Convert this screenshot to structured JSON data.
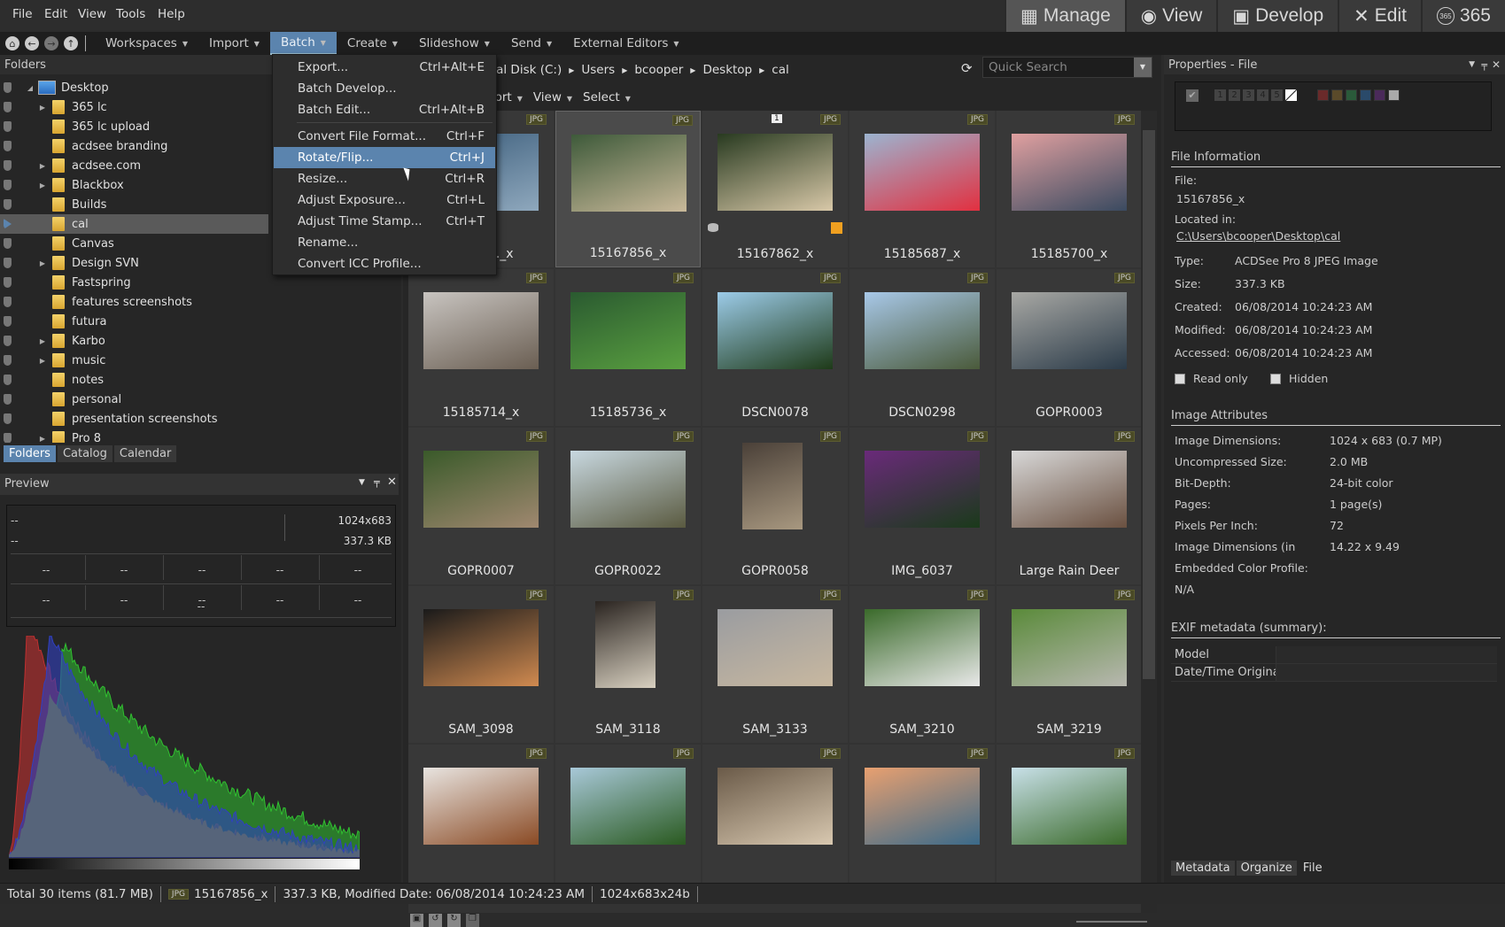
{
  "menubar": {
    "items": [
      "File",
      "Edit",
      "View",
      "Tools",
      "Help"
    ]
  },
  "modes": [
    {
      "label": "Manage",
      "icon": "grid-icon",
      "active": true
    },
    {
      "label": "View",
      "icon": "eye-icon"
    },
    {
      "label": "Develop",
      "icon": "image-icon"
    },
    {
      "label": "Edit",
      "icon": "tools-icon"
    },
    {
      "label": "365",
      "icon": "365-icon",
      "glyph": "365"
    }
  ],
  "toolbar": {
    "items": [
      "Workspaces",
      "Import",
      "Batch",
      "Create",
      "Slideshow",
      "Send",
      "External Editors"
    ],
    "active": "Batch"
  },
  "batch_menu": [
    {
      "label": "Export...",
      "shortcut": "Ctrl+Alt+E"
    },
    {
      "label": "Batch Develop...",
      "shortcut": ""
    },
    {
      "label": "Batch Edit...",
      "shortcut": "Ctrl+Alt+B"
    },
    {
      "label": "Convert File Format...",
      "shortcut": "Ctrl+F"
    },
    {
      "label": "Rotate/Flip...",
      "shortcut": "Ctrl+J",
      "highlighted": true
    },
    {
      "label": "Resize...",
      "shortcut": "Ctrl+R"
    },
    {
      "label": "Adjust Exposure...",
      "shortcut": "Ctrl+L"
    },
    {
      "label": "Adjust Time Stamp...",
      "shortcut": "Ctrl+T"
    },
    {
      "label": "Rename...",
      "shortcut": ""
    },
    {
      "label": "Convert ICC Profile...",
      "shortcut": ""
    }
  ],
  "folders": {
    "title": "Folders",
    "items": [
      {
        "label": "Desktop",
        "root": true
      },
      {
        "label": "365 lc",
        "exp": true
      },
      {
        "label": "365 lc upload"
      },
      {
        "label": "acdsee branding"
      },
      {
        "label": "acdsee.com",
        "exp": true
      },
      {
        "label": "Blackbox",
        "exp": true
      },
      {
        "label": "Builds"
      },
      {
        "label": "cal",
        "selected": true
      },
      {
        "label": "Canvas"
      },
      {
        "label": "Design SVN",
        "exp": true
      },
      {
        "label": "Fastspring"
      },
      {
        "label": "features screenshots"
      },
      {
        "label": "futura"
      },
      {
        "label": "Karbo",
        "exp": true
      },
      {
        "label": "music",
        "exp": true
      },
      {
        "label": "notes"
      },
      {
        "label": "personal"
      },
      {
        "label": "presentation screenshots"
      },
      {
        "label": "Pro 8",
        "exp": true
      }
    ],
    "tabs": [
      "Folders",
      "Catalog",
      "Calendar"
    ],
    "active_tab": "Folders"
  },
  "preview": {
    "title": "Preview",
    "dimensions": "1024x683",
    "size": "337.3 KB",
    "placeholder": "--"
  },
  "address": {
    "crumbs": [
      "Local Disk (C:)",
      "Users",
      "bcooper",
      "Desktop",
      "cal"
    ],
    "search_placeholder": "Quick Search"
  },
  "sortbar": [
    "Sort",
    "View",
    "Select"
  ],
  "thumbnails": [
    {
      "name": "15185..._x",
      "colors": [
        "#3a5c7a",
        "#8fa8bd"
      ],
      "partial": true
    },
    {
      "name": "15167856_x",
      "colors": [
        "#3e5a3a",
        "#c9b99a"
      ],
      "selected": true
    },
    {
      "name": "15167862_x",
      "colors": [
        "#283a20",
        "#d8c8a8"
      ],
      "label_num": "1",
      "tagged": true
    },
    {
      "name": "15185687_x",
      "colors": [
        "#9cb4d0",
        "#e23040"
      ]
    },
    {
      "name": "15185700_x",
      "colors": [
        "#e0a0a0",
        "#3a4a60"
      ]
    },
    {
      "name": "15185714_x",
      "colors": [
        "#c8c4c0",
        "#6a5e52"
      ]
    },
    {
      "name": "15185736_x",
      "colors": [
        "#2a5a30",
        "#5aa040"
      ]
    },
    {
      "name": "DSCN0078",
      "colors": [
        "#9ccbe8",
        "#1e3a18"
      ]
    },
    {
      "name": "DSCN0298",
      "colors": [
        "#a8c8e8",
        "#4a5a3a"
      ]
    },
    {
      "name": "GOPR0003",
      "colors": [
        "#a8a8a4",
        "#2a3a48"
      ]
    },
    {
      "name": "GOPR0007",
      "colors": [
        "#3a5a2a",
        "#a08870"
      ]
    },
    {
      "name": "GOPR0022",
      "colors": [
        "#c8d8e0",
        "#5a5a40"
      ]
    },
    {
      "name": "GOPR0058",
      "colors": [
        "#4a4038",
        "#a89880"
      ],
      "portrait": true
    },
    {
      "name": "IMG_6037",
      "colors": [
        "#6a2a7a",
        "#1a3a1a"
      ]
    },
    {
      "name": "Large Rain Deer",
      "colors": [
        "#d8d8d8",
        "#6a5040"
      ]
    },
    {
      "name": "SAM_3098",
      "colors": [
        "#1a1a1a",
        "#d08a50"
      ]
    },
    {
      "name": "SAM_3118",
      "colors": [
        "#2a2420",
        "#d8d0c0"
      ],
      "portrait": true
    },
    {
      "name": "SAM_3133",
      "colors": [
        "#9a9ca0",
        "#c8b8a0"
      ]
    },
    {
      "name": "SAM_3210",
      "colors": [
        "#3a6a2a",
        "#e8e8e8"
      ]
    },
    {
      "name": "SAM_3219",
      "colors": [
        "#5a8a3a",
        "#b8b8b0"
      ]
    },
    {
      "name": "",
      "colors": [
        "#e8e4e0",
        "#8a4a24"
      ]
    },
    {
      "name": "",
      "colors": [
        "#a8c8d8",
        "#2a5a20"
      ]
    },
    {
      "name": "",
      "colors": [
        "#6a5a48",
        "#d8c8b0"
      ]
    },
    {
      "name": "",
      "colors": [
        "#e8a070",
        "#3a6a8a"
      ]
    },
    {
      "name": "",
      "colors": [
        "#c8e0e8",
        "#3a6a2a"
      ]
    }
  ],
  "badge": "JPG",
  "properties": {
    "title": "Properties - File",
    "ratings": [
      "1",
      "2",
      "3",
      "4",
      "5"
    ],
    "color_labels": [
      "#6a2a2a",
      "#5a4a2a",
      "#2a5a3a",
      "#2a4a6a",
      "#4a2a5a",
      "#aaaaaa"
    ],
    "file_info": {
      "title": "File Information",
      "file_label": "File:",
      "file": "15167856_x",
      "located_label": "Located in:",
      "located": "C:\\Users\\bcooper\\Desktop\\cal",
      "rows": [
        [
          "Type:",
          "ACDSee Pro 8 JPEG Image"
        ],
        [
          "Size:",
          "337.3 KB"
        ],
        [
          "Created:",
          "06/08/2014 10:24:23 AM"
        ],
        [
          "Modified:",
          "06/08/2014 10:24:23 AM"
        ],
        [
          "Accessed:",
          "06/08/2014 10:24:23 AM"
        ]
      ],
      "read_only": "Read only",
      "hidden": "Hidden"
    },
    "image_attributes": {
      "title": "Image Attributes",
      "rows": [
        [
          "Image Dimensions:",
          "1024 x 683 (0.7 MP)"
        ],
        [
          "Uncompressed Size:",
          "2.0 MB"
        ],
        [
          "Bit-Depth:",
          "24-bit color"
        ],
        [
          "Pages:",
          "1 page(s)"
        ],
        [
          "Pixels Per Inch:",
          "72"
        ],
        [
          "Image Dimensions (in",
          "14.22 x 9.49"
        ],
        [
          "Embedded Color Profile:",
          ""
        ],
        [
          "N/A",
          ""
        ]
      ]
    },
    "exif": {
      "title": "EXIF metadata (summary):",
      "rows": [
        "Model",
        "Date/Time Original"
      ]
    },
    "tabs": [
      "Metadata",
      "Organize",
      "File"
    ],
    "active_tab": "File"
  },
  "status": {
    "total": "Total 30 items  (81.7 MB)",
    "file": "15167856_x",
    "info": "337.3 KB, Modified Date: 06/08/2014 10:24:23 AM",
    "dims": "1024x683x24b"
  }
}
